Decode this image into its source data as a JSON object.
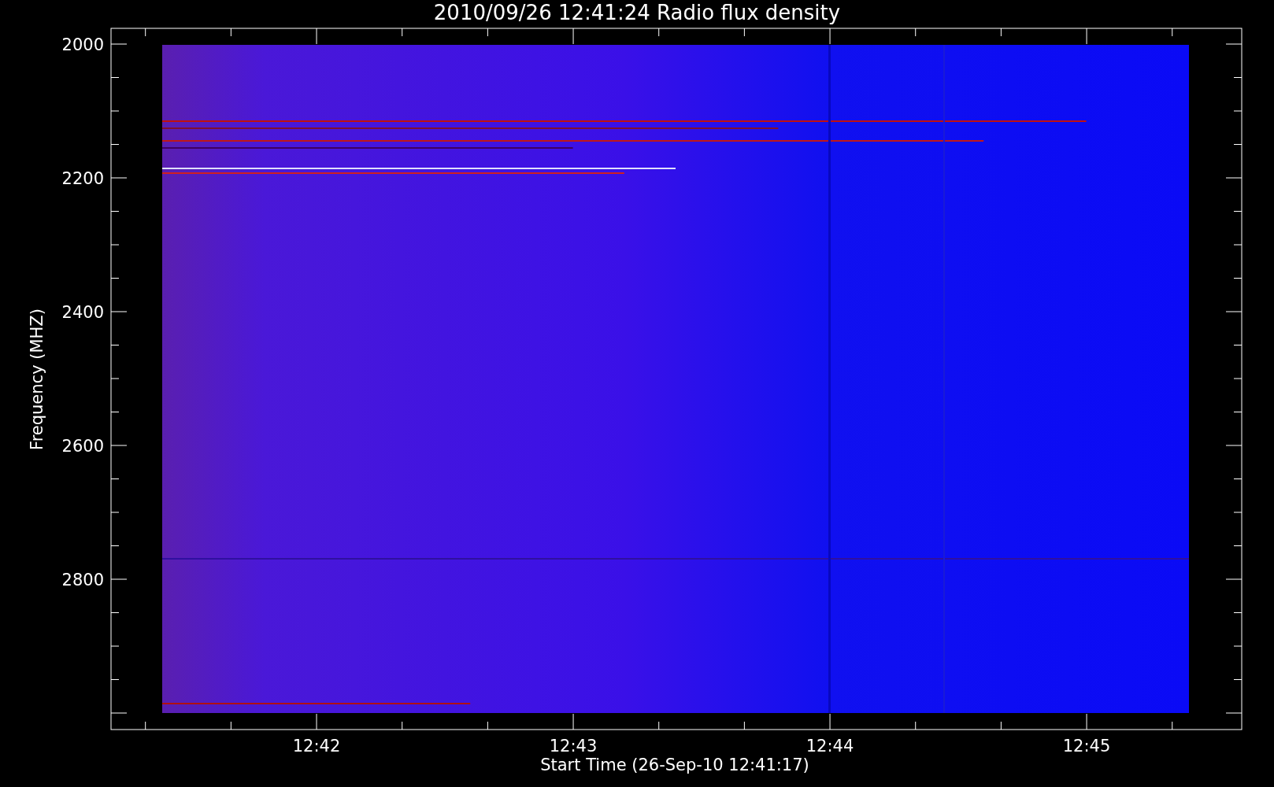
{
  "plot": {
    "title": "2010/09/26 12:41:24 Radio flux density",
    "y_axis": {
      "label": "Frequency (MHZ)",
      "ticks": [
        "2000",
        "2200",
        "2400",
        "2600",
        "2800"
      ]
    },
    "x_axis": {
      "label": "Start Time (26-Sep-10 12:41:17)",
      "ticks": [
        "12:42",
        "12:43",
        "12:44",
        "12:45"
      ]
    }
  }
}
